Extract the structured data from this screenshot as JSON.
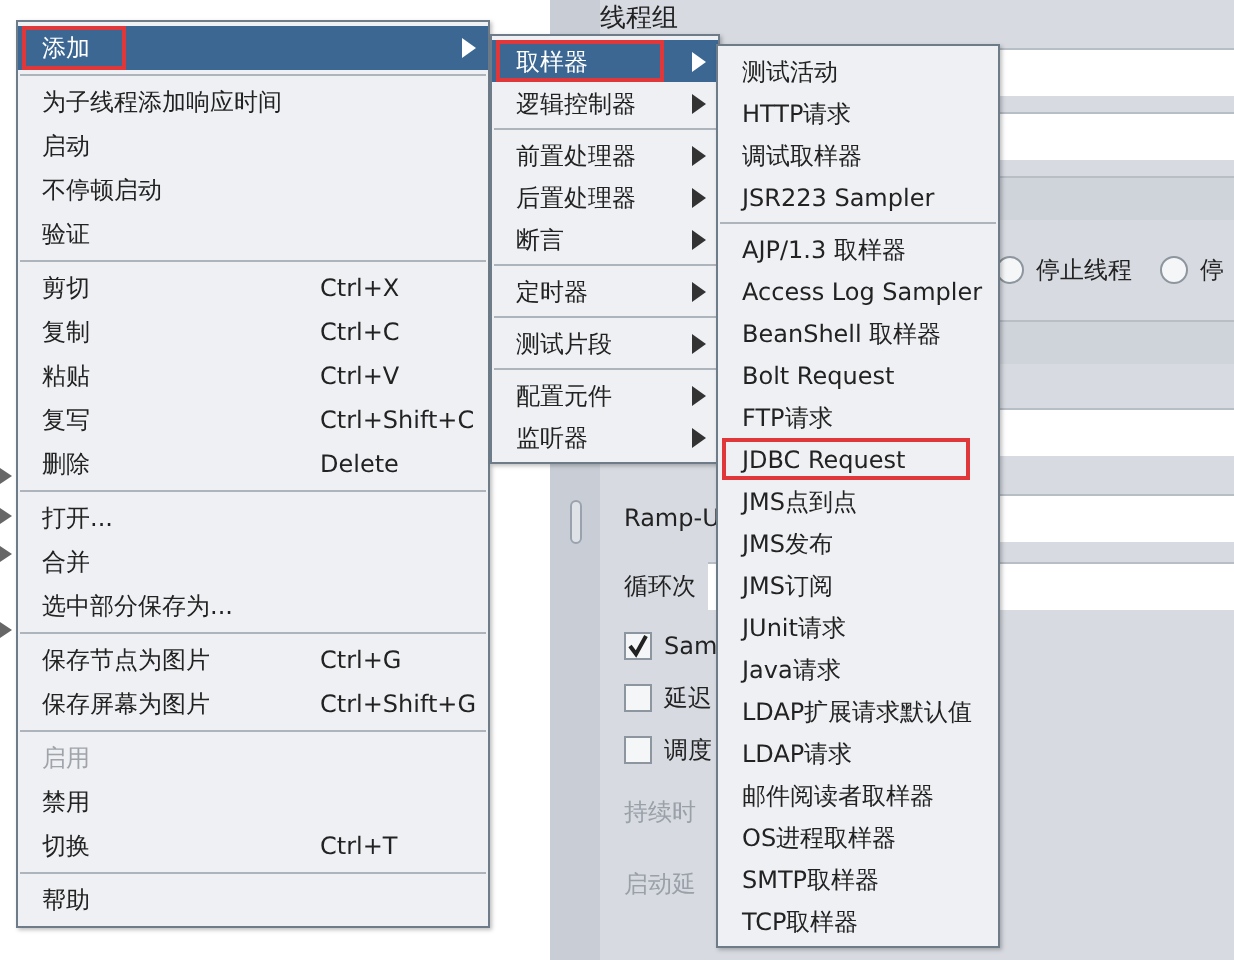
{
  "panel": {
    "title": "线程组",
    "radios": [
      {
        "label": "停止线程",
        "selected": false
      },
      {
        "label": "停",
        "selected": false
      }
    ],
    "fields": [
      {
        "label": "Ramp-U"
      },
      {
        "label": "循环次"
      }
    ],
    "checkboxes": [
      {
        "label": "Sam",
        "checked": true
      },
      {
        "label": "延迟",
        "checked": false
      },
      {
        "label": "调度",
        "checked": false
      }
    ],
    "disabled_labels": [
      "持续时",
      "启动延"
    ]
  },
  "context_menu": {
    "groups": [
      [
        {
          "label": "添加",
          "submenu": true,
          "selected": true,
          "disabled": false,
          "boxed": true
        }
      ],
      [
        {
          "label": "为子线程添加响应时间",
          "submenu": false,
          "selected": false,
          "disabled": false,
          "boxed": false
        },
        {
          "label": "启动",
          "submenu": false,
          "selected": false,
          "disabled": false,
          "boxed": false
        },
        {
          "label": "不停顿启动",
          "submenu": false,
          "selected": false,
          "disabled": false,
          "boxed": false
        },
        {
          "label": "验证",
          "submenu": false,
          "selected": false,
          "disabled": false,
          "boxed": false
        }
      ],
      [
        {
          "label": "剪切",
          "shortcut": "Ctrl+X",
          "submenu": false,
          "selected": false,
          "disabled": false,
          "boxed": false
        },
        {
          "label": "复制",
          "shortcut": "Ctrl+C",
          "submenu": false,
          "selected": false,
          "disabled": false,
          "boxed": false
        },
        {
          "label": "粘贴",
          "shortcut": "Ctrl+V",
          "submenu": false,
          "selected": false,
          "disabled": false,
          "boxed": false
        },
        {
          "label": "复写",
          "shortcut": "Ctrl+Shift+C",
          "submenu": false,
          "selected": false,
          "disabled": false,
          "boxed": false
        },
        {
          "label": "删除",
          "shortcut": "Delete",
          "submenu": false,
          "selected": false,
          "disabled": false,
          "boxed": false
        }
      ],
      [
        {
          "label": "打开...",
          "submenu": false,
          "selected": false,
          "disabled": false,
          "boxed": false
        },
        {
          "label": "合并",
          "submenu": false,
          "selected": false,
          "disabled": false,
          "boxed": false
        },
        {
          "label": "选中部分保存为...",
          "submenu": false,
          "selected": false,
          "disabled": false,
          "boxed": false
        }
      ],
      [
        {
          "label": "保存节点为图片",
          "shortcut": "Ctrl+G",
          "submenu": false,
          "selected": false,
          "disabled": false,
          "boxed": false
        },
        {
          "label": "保存屏幕为图片",
          "shortcut": "Ctrl+Shift+G",
          "submenu": false,
          "selected": false,
          "disabled": false,
          "boxed": false
        }
      ],
      [
        {
          "label": "启用",
          "submenu": false,
          "selected": false,
          "disabled": true,
          "boxed": false
        },
        {
          "label": "禁用",
          "submenu": false,
          "selected": false,
          "disabled": false,
          "boxed": false
        },
        {
          "label": "切换",
          "shortcut": "Ctrl+T",
          "submenu": false,
          "selected": false,
          "disabled": false,
          "boxed": false
        }
      ],
      [
        {
          "label": "帮助",
          "submenu": false,
          "selected": false,
          "disabled": false,
          "boxed": false
        }
      ]
    ]
  },
  "add_submenu": {
    "groups": [
      [
        {
          "label": "取样器",
          "submenu": true,
          "selected": true,
          "boxed": true
        },
        {
          "label": "逻辑控制器",
          "submenu": true,
          "selected": false,
          "boxed": false
        }
      ],
      [
        {
          "label": "前置处理器",
          "submenu": true,
          "selected": false,
          "boxed": false
        },
        {
          "label": "后置处理器",
          "submenu": true,
          "selected": false,
          "boxed": false
        },
        {
          "label": "断言",
          "submenu": true,
          "selected": false,
          "boxed": false
        }
      ],
      [
        {
          "label": "定时器",
          "submenu": true,
          "selected": false,
          "boxed": false
        }
      ],
      [
        {
          "label": "测试片段",
          "submenu": true,
          "selected": false,
          "boxed": false
        }
      ],
      [
        {
          "label": "配置元件",
          "submenu": true,
          "selected": false,
          "boxed": false
        },
        {
          "label": "监听器",
          "submenu": true,
          "selected": false,
          "boxed": false
        }
      ]
    ]
  },
  "sampler_submenu": {
    "groups": [
      [
        {
          "label": "测试活动",
          "boxed": false
        },
        {
          "label": "HTTP请求",
          "boxed": false
        },
        {
          "label": "调试取样器",
          "boxed": false
        },
        {
          "label": "JSR223 Sampler",
          "boxed": false
        }
      ],
      [
        {
          "label": "AJP/1.3 取样器",
          "boxed": false
        },
        {
          "label": "Access Log Sampler",
          "boxed": false
        },
        {
          "label": "BeanShell 取样器",
          "boxed": false
        },
        {
          "label": "Bolt Request",
          "boxed": false
        },
        {
          "label": "FTP请求",
          "boxed": false
        },
        {
          "label": "JDBC Request",
          "boxed": true
        },
        {
          "label": "JMS点到点",
          "boxed": false
        },
        {
          "label": "JMS发布",
          "boxed": false
        },
        {
          "label": "JMS订阅",
          "boxed": false
        },
        {
          "label": "JUnit请求",
          "boxed": false
        },
        {
          "label": "Java请求",
          "boxed": false
        },
        {
          "label": "LDAP扩展请求默认值",
          "boxed": false
        },
        {
          "label": "LDAP请求",
          "boxed": false
        },
        {
          "label": "邮件阅读者取样器",
          "boxed": false
        },
        {
          "label": "OS进程取样器",
          "boxed": false
        },
        {
          "label": "SMTP取样器",
          "boxed": false
        },
        {
          "label": "TCP取样器",
          "boxed": false
        }
      ]
    ]
  }
}
